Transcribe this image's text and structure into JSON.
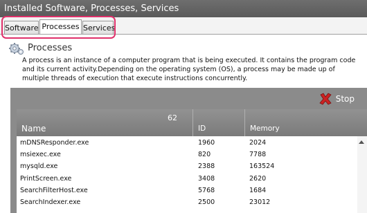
{
  "window": {
    "title": "Installed Software, Processes, Services"
  },
  "tabs": [
    {
      "label": "Software",
      "active": false
    },
    {
      "label": "Processes",
      "active": true
    },
    {
      "label": "Services",
      "active": false
    }
  ],
  "header": {
    "icon": "gears-icon",
    "title": "Processes",
    "description": "A process is an instance of a computer program that is being executed. It contains the program code and its current activity.Depending on the operating system (OS), a process may be made up of multiple threads of execution that execute instructions concurrently."
  },
  "toolbar": {
    "stop_label": "Stop",
    "stop_icon": "red-x-icon"
  },
  "table": {
    "count": "62",
    "columns": {
      "name": "Name",
      "id": "ID",
      "memory": "Memory"
    },
    "rows": [
      {
        "name": "mDNSResponder.exe",
        "id": "1960",
        "memory": "2024"
      },
      {
        "name": "msiexec.exe",
        "id": "820",
        "memory": "7788"
      },
      {
        "name": "mysqld.exe",
        "id": "2388",
        "memory": "163524"
      },
      {
        "name": "PrintScreen.exe",
        "id": "3408",
        "memory": "2620"
      },
      {
        "name": "SearchFilterHost.exe",
        "id": "5768",
        "memory": "1684"
      },
      {
        "name": "SearchIndexer.exe",
        "id": "2500",
        "memory": "23012"
      }
    ]
  },
  "colors": {
    "highlight": "#e0306a",
    "stop_x": "#cc2222",
    "panel": "#8b8b8b"
  }
}
